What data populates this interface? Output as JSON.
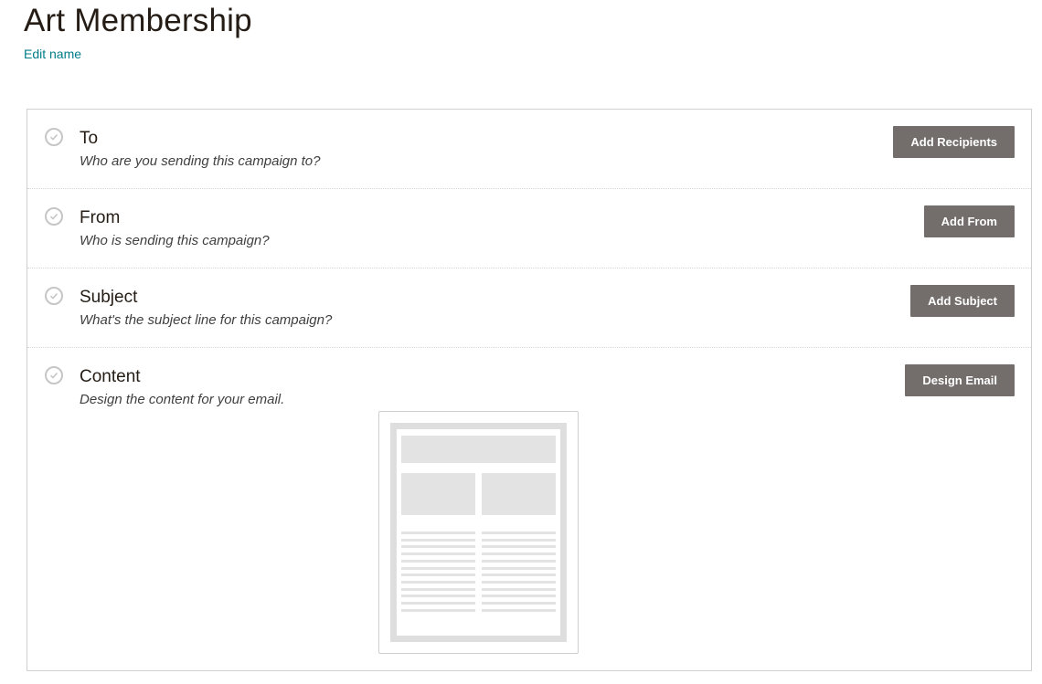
{
  "campaign": {
    "title": "Art Membership",
    "edit_name_label": "Edit name"
  },
  "checklist": [
    {
      "id": "to",
      "title": "To",
      "subtitle": "Who are you sending this campaign to?",
      "button_label": "Add Recipients"
    },
    {
      "id": "from",
      "title": "From",
      "subtitle": "Who is sending this campaign?",
      "button_label": "Add From"
    },
    {
      "id": "subject",
      "title": "Subject",
      "subtitle": "What's the subject line for this campaign?",
      "button_label": "Add Subject"
    },
    {
      "id": "content",
      "title": "Content",
      "subtitle": "Design the content for your email.",
      "button_label": "Design Email"
    }
  ],
  "icons": {
    "step_status": "check-circle-icon",
    "content_preview": "email-template-preview"
  },
  "colors": {
    "link": "#007c89",
    "button_bg": "#736e6b",
    "button_text": "#ffffff",
    "check_incomplete": "#c6c6c6"
  }
}
